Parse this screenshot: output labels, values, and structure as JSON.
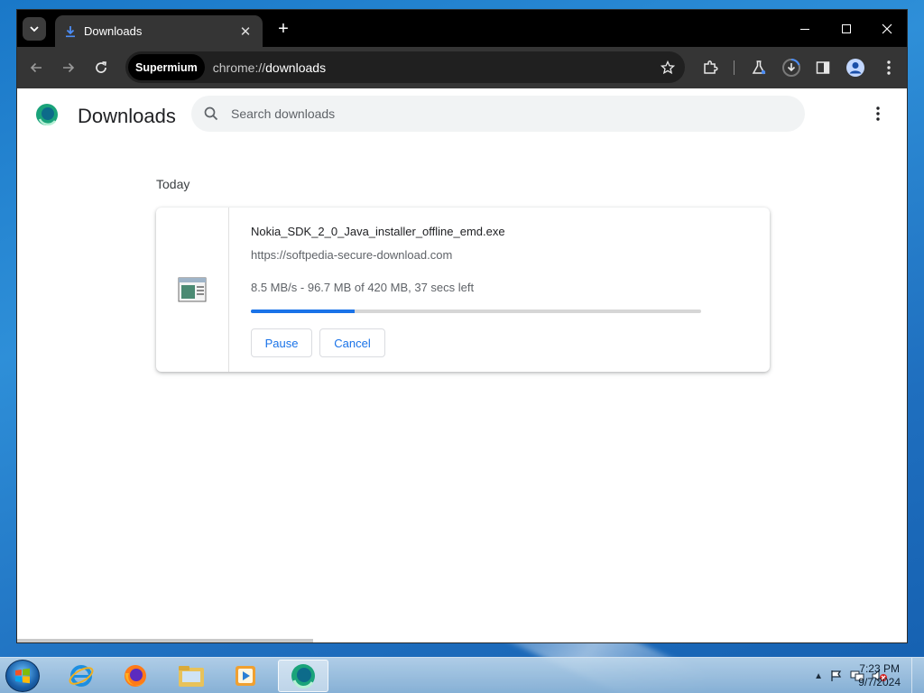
{
  "browser": {
    "tab": {
      "title": "Downloads"
    },
    "new_tab_label": "+",
    "origin_chip": "Supermium",
    "url": {
      "scheme": "chrome://",
      "path": "downloads"
    }
  },
  "page": {
    "title": "Downloads",
    "search": {
      "placeholder": "Search downloads",
      "value": ""
    },
    "date_header": "Today",
    "download": {
      "file_name": "Nokia_SDK_2_0_Java_installer_offline_emd.exe",
      "source_url": "https://softpedia-secure-download.com",
      "status": "8.5 MB/s - 96.7 MB of 420 MB, 37 secs left",
      "progress_fraction": 0.23,
      "pause_label": "Pause",
      "cancel_label": "Cancel"
    }
  },
  "taskbar": {
    "clock_time": "7:23 PM",
    "clock_date": "9/7/2024",
    "apps": [
      "internet-explorer-icon",
      "firefox-icon",
      "file-explorer-icon",
      "media-player-icon",
      "supermium-icon"
    ]
  },
  "colors": {
    "accent": "#1a73e8",
    "tabstrip": "#000000",
    "toolbar": "#353535",
    "omnibox": "#202020"
  }
}
